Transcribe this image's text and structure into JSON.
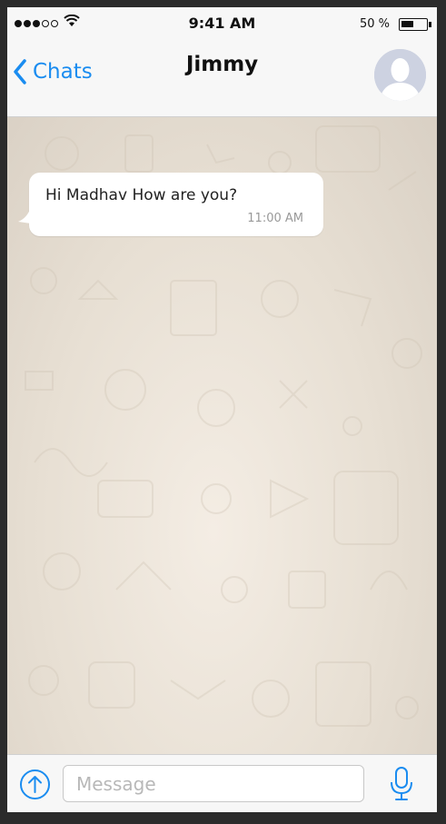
{
  "status_bar": {
    "time": "9:41 AM",
    "battery_percent_label": "50 %",
    "battery_level": 0.5,
    "signal_bars_filled": 3,
    "signal_bars_total": 5
  },
  "nav": {
    "back_label": "Chats",
    "contact_name": "Jimmy"
  },
  "messages": [
    {
      "text": "Hi Madhav How are you?",
      "time": "11:00 AM",
      "direction": "incoming"
    }
  ],
  "input": {
    "placeholder": "Message",
    "value": ""
  },
  "icons": {
    "back": "chevron-left-icon",
    "attach": "upload-arrow-icon",
    "mic": "microphone-icon",
    "avatar": "person-silhouette-icon"
  },
  "colors": {
    "accent": "#1a8cf0",
    "bubble_incoming": "#ffffff",
    "bar_background": "#f7f7f7",
    "chat_background": "#ece5dd"
  }
}
